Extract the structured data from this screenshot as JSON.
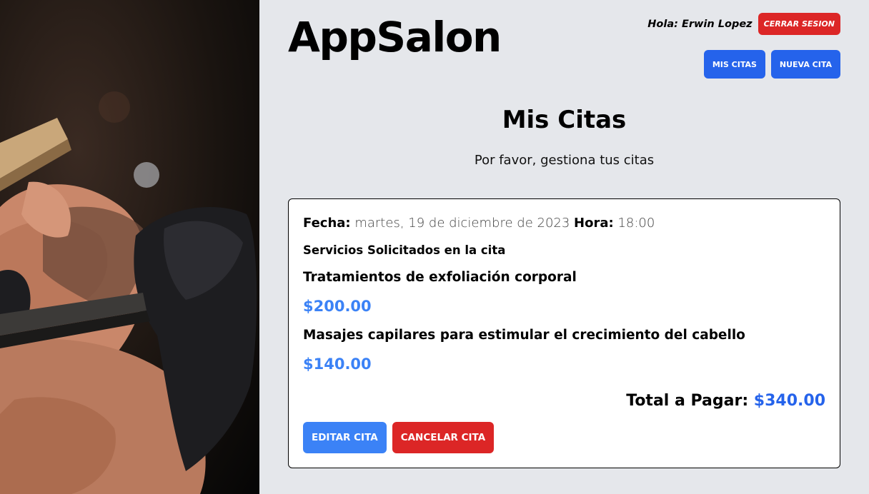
{
  "app": {
    "logo": "AppSalon"
  },
  "user": {
    "greeting": "Hola: Erwin Lopez",
    "logout_label": "CERRAR SESION"
  },
  "nav": {
    "mis_citas": "MIS CITAS",
    "nueva_cita": "NUEVA CITA"
  },
  "page": {
    "title": "Mis Citas",
    "subtitle": "Por favor, gestiona tus citas"
  },
  "cita": {
    "fecha_label": "Fecha:",
    "fecha_value": "martes, 19 de diciembre de 2023",
    "hora_label": "Hora:",
    "hora_value": "18:00",
    "services_heading": "Servicios Solicitados en la cita",
    "services": [
      {
        "name": "Tratamientos de exfoliación corporal",
        "price": "$200.00"
      },
      {
        "name": "Masajes capilares para estimular el crecimiento del cabello",
        "price": "$140.00"
      }
    ],
    "total_label": "Total a Pagar:",
    "total_value": "$340.00",
    "edit_label": "EDITAR CITA",
    "cancel_label": "CANCELAR CITA"
  },
  "colors": {
    "blue": "#2563eb",
    "light_blue": "#3b82f6",
    "red": "#dc2626",
    "bg": "#e5e7eb"
  },
  "hero_image": "barber-shaving-photo"
}
